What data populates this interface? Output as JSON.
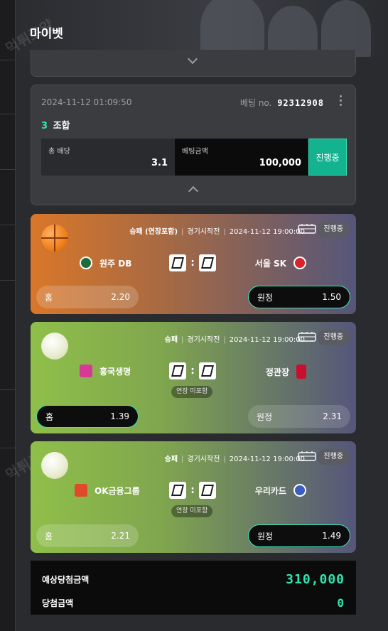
{
  "header": {
    "title": "마이벳"
  },
  "watermark": {
    "text": "먹튀로얄"
  },
  "bet": {
    "datetime": "2024-11-12 01:09:50",
    "bet_no_label": "베팅 no.",
    "bet_no": "92312908",
    "combo_count": "3",
    "combo_label": "조합",
    "total_odds_label": "총 배당",
    "total_odds": "3.1",
    "bet_amount_label": "베팅금액",
    "bet_amount": "100,000",
    "status": "진행중"
  },
  "matches": [
    {
      "sport_icon": "basketball-icon",
      "market": "승패 (연장포함)",
      "state": "경기시작전",
      "datetime": "2024-11-12 19:00:00",
      "status": "진행중",
      "home_team": "원주 DB",
      "away_team": "서울 SK",
      "home_score": "0",
      "away_score": "0",
      "overtime_note": "",
      "home_label": "홈",
      "home_odds": "2.20",
      "away_label": "원정",
      "away_odds": "1.50",
      "selected": "away"
    },
    {
      "sport_icon": "volleyball-icon",
      "market": "승패",
      "state": "경기시작전",
      "datetime": "2024-11-12 19:00:00",
      "status": "진행중",
      "home_team": "흥국생명",
      "away_team": "정관장",
      "home_score": "0",
      "away_score": "0",
      "overtime_note": "연장 미포함",
      "home_label": "홈",
      "home_odds": "1.39",
      "away_label": "원정",
      "away_odds": "2.31",
      "selected": "home"
    },
    {
      "sport_icon": "volleyball-icon",
      "market": "승패",
      "state": "경기시작전",
      "datetime": "2024-11-12 19:00:00",
      "status": "진행중",
      "home_team": "OK금융그룹",
      "away_team": "우리카드",
      "home_score": "0",
      "away_score": "0",
      "overtime_note": "연장 미포함",
      "home_label": "홈",
      "home_odds": "2.21",
      "away_label": "원정",
      "away_odds": "1.49",
      "selected": "away"
    }
  ],
  "summary": {
    "expected_label": "예상당첨금액",
    "expected_value": "310,000",
    "won_label": "당첨금액",
    "won_value": "0"
  },
  "colors": {
    "accent": "#2ee6b0",
    "basketball_card": "#d9772a",
    "volleyball_card": "#8fbf4a",
    "card_bg": "#3a3c40"
  }
}
